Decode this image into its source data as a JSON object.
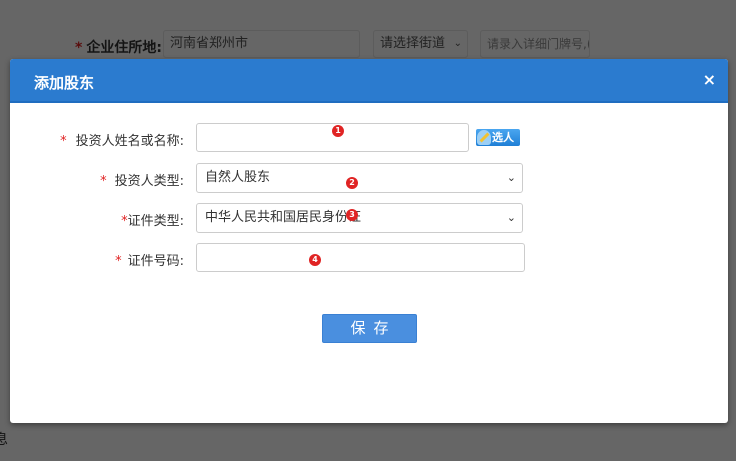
{
  "background": {
    "address_label": "企业住所地:",
    "address_value": "河南省郑州市",
    "street_select": "请选择街道",
    "detail_placeholder": "请录入详细门牌号,(",
    "bottom_fragment": "息"
  },
  "modal": {
    "title": "添加股东",
    "close_icon": "×",
    "required_mark": "*",
    "fields": [
      {
        "label": "投资人姓名或名称:",
        "value": "",
        "badge": "1"
      },
      {
        "label": "投资人类型:",
        "value": "自然人股东",
        "badge": "2"
      },
      {
        "label": "证件类型:",
        "value": "中华人民共和国居民身份证",
        "badge": "3"
      },
      {
        "label": "证件号码:",
        "value": "",
        "badge": "4"
      }
    ],
    "pick_person_label": "选人",
    "save_label": "保存"
  },
  "colors": {
    "header": "#2b7bcf",
    "save": "#4a8fdf",
    "required": "#e02020",
    "badge": "#e02424"
  }
}
